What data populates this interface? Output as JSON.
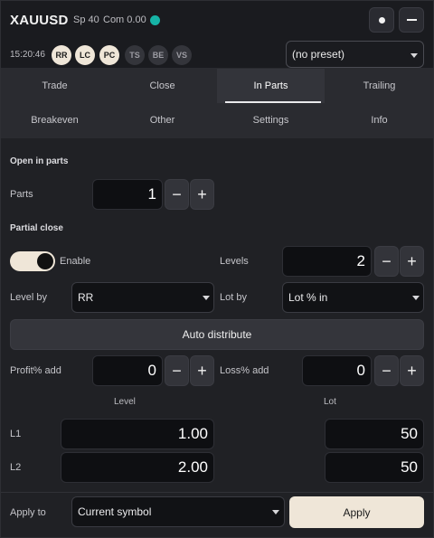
{
  "header": {
    "symbol": "XAUUSD",
    "spread": "Sp 40",
    "commission": "Com 0.00",
    "clock": "15:20:46",
    "chips": [
      {
        "label": "RR",
        "active": true
      },
      {
        "label": "LC",
        "active": true
      },
      {
        "label": "PC",
        "active": true
      },
      {
        "label": "TS",
        "active": false
      },
      {
        "label": "BE",
        "active": false
      },
      {
        "label": "VS",
        "active": false
      }
    ],
    "preset": "(no preset)"
  },
  "tabs": [
    "Trade",
    "Close",
    "In Parts",
    "Trailing",
    "Breakeven",
    "Other",
    "Settings",
    "Info"
  ],
  "active_tab": "In Parts",
  "open_in_parts": {
    "title": "Open in parts",
    "parts_label": "Parts",
    "parts_value": "1"
  },
  "partial_close": {
    "title": "Partial close",
    "enable_label": "Enable",
    "enabled": true,
    "levels_label": "Levels",
    "levels_value": "2",
    "level_by_label": "Level by",
    "level_by_value": "RR",
    "lot_by_label": "Lot by",
    "lot_by_value": "Lot % in",
    "auto_distribute": "Auto distribute",
    "profit_add_label": "Profit% add",
    "profit_add_value": "0",
    "loss_add_label": "Loss% add",
    "loss_add_value": "0",
    "col_level": "Level",
    "col_lot": "Lot",
    "rows": [
      {
        "label": "L1",
        "level": "1.00",
        "lot": "50"
      },
      {
        "label": "L2",
        "level": "2.00",
        "lot": "50"
      }
    ]
  },
  "footer": {
    "apply_to_label": "Apply to",
    "apply_to_value": "Current symbol",
    "apply_button": "Apply"
  },
  "colors": {
    "accent_cream": "#efe6d8",
    "live_teal": "#16b3a6",
    "background": "#202125"
  }
}
